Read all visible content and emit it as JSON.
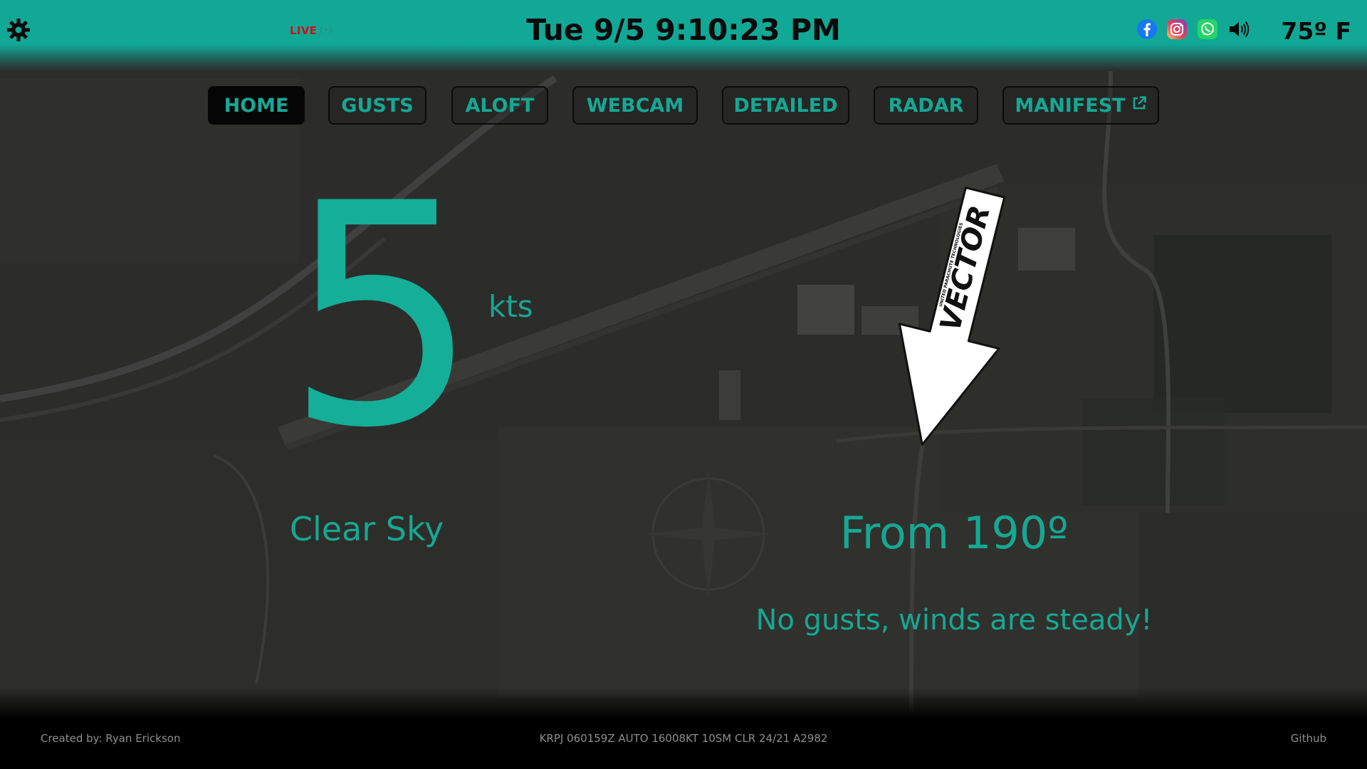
{
  "header": {
    "live_label": "LIVE",
    "clock": "Tue 9/5 9:10:23 PM",
    "temperature": "75º F",
    "social": [
      "facebook-icon",
      "instagram-icon",
      "whatsapp-icon",
      "speaker-icon"
    ]
  },
  "nav": {
    "items": [
      {
        "label": "HOME",
        "active": true
      },
      {
        "label": "GUSTS",
        "active": false
      },
      {
        "label": "ALOFT",
        "active": false
      },
      {
        "label": "WEBCAM",
        "active": false
      },
      {
        "label": "DETAILED",
        "active": false
      },
      {
        "label": "RADAR",
        "active": false
      },
      {
        "label": "MANIFEST",
        "active": false,
        "icon": "external-link-icon"
      }
    ]
  },
  "wind": {
    "speed": "5",
    "unit": "kts",
    "sky": "Clear Sky",
    "direction": "From 190º",
    "gust_message": "No gusts, winds are steady!",
    "arrow_brand": "VECTOR",
    "arrow_subtext": "UNITED PARACHUTE TECHNOLOGIES"
  },
  "footer": {
    "credit": "Created by: Ryan Erickson",
    "metar": "KRPJ 060159Z AUTO 16008KT 10SM CLR 24/21 A2982",
    "github": "Github"
  },
  "colors": {
    "accent": "#15a894",
    "header_bg": "#11a896",
    "live_red": "#c8141a"
  }
}
